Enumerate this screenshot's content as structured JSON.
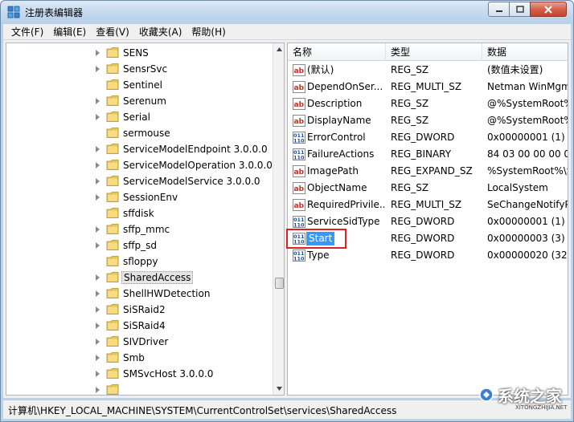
{
  "window": {
    "title": "注册表编辑器",
    "accent": "#3399ff",
    "highlight_color": "#e02020"
  },
  "menu": [
    "文件(F)",
    "编辑(E)",
    "查看(V)",
    "收藏夹(A)",
    "帮助(H)"
  ],
  "tree": {
    "items": [
      {
        "label": "SENS",
        "expandable": true
      },
      {
        "label": "SensrSvc",
        "expandable": true
      },
      {
        "label": "Sentinel",
        "expandable": false
      },
      {
        "label": "Serenum",
        "expandable": true
      },
      {
        "label": "Serial",
        "expandable": true
      },
      {
        "label": "sermouse",
        "expandable": false
      },
      {
        "label": "ServiceModelEndpoint 3.0.0.0",
        "expandable": true
      },
      {
        "label": "ServiceModelOperation 3.0.0.0",
        "expandable": true
      },
      {
        "label": "ServiceModelService 3.0.0.0",
        "expandable": true
      },
      {
        "label": "SessionEnv",
        "expandable": true
      },
      {
        "label": "sffdisk",
        "expandable": false
      },
      {
        "label": "sffp_mmc",
        "expandable": true
      },
      {
        "label": "sffp_sd",
        "expandable": true
      },
      {
        "label": "sfloppy",
        "expandable": false
      },
      {
        "label": "SharedAccess",
        "expandable": true,
        "selected": true
      },
      {
        "label": "ShellHWDetection",
        "expandable": true
      },
      {
        "label": "SiSRaid2",
        "expandable": true
      },
      {
        "label": "SiSRaid4",
        "expandable": true
      },
      {
        "label": "SIVDriver",
        "expandable": true
      },
      {
        "label": "Smb",
        "expandable": true
      },
      {
        "label": "SMSvcHost 3.0.0.0",
        "expandable": true
      },
      {
        "label": "",
        "expandable": true
      }
    ]
  },
  "list": {
    "columns": [
      "名称",
      "类型",
      "数据"
    ],
    "rows": [
      {
        "icon": "string-value-icon",
        "name": "(默认)",
        "type": "REG_SZ",
        "data": "(数值未设置)"
      },
      {
        "icon": "string-value-icon",
        "name": "DependOnSer...",
        "type": "REG_MULTI_SZ",
        "data": "Netman WinMgm"
      },
      {
        "icon": "string-value-icon",
        "name": "Description",
        "type": "REG_SZ",
        "data": "@%SystemRoot%"
      },
      {
        "icon": "string-value-icon",
        "name": "DisplayName",
        "type": "REG_SZ",
        "data": "@%SystemRoot%"
      },
      {
        "icon": "binary-value-icon",
        "name": "ErrorControl",
        "type": "REG_DWORD",
        "data": "0x00000001 (1)"
      },
      {
        "icon": "binary-value-icon",
        "name": "FailureActions",
        "type": "REG_BINARY",
        "data": "84 03 00 00 00 00"
      },
      {
        "icon": "string-value-icon",
        "name": "ImagePath",
        "type": "REG_EXPAND_SZ",
        "data": "%SystemRoot%\\S"
      },
      {
        "icon": "string-value-icon",
        "name": "ObjectName",
        "type": "REG_SZ",
        "data": "LocalSystem"
      },
      {
        "icon": "string-value-icon",
        "name": "RequiredPrivile...",
        "type": "REG_MULTI_SZ",
        "data": "SeChangeNotifyP"
      },
      {
        "icon": "binary-value-icon",
        "name": "ServiceSidType",
        "type": "REG_DWORD",
        "data": "0x00000001 (1)"
      },
      {
        "icon": "binary-value-icon",
        "name": "Start",
        "type": "REG_DWORD",
        "data": "0x00000003 (3)",
        "selected": true
      },
      {
        "icon": "binary-value-icon",
        "name": "Type",
        "type": "REG_DWORD",
        "data": "0x00000020 (32)"
      }
    ]
  },
  "status": {
    "path": "计算机\\HKEY_LOCAL_MACHINE\\SYSTEM\\CurrentControlSet\\services\\SharedAccess"
  },
  "watermark": {
    "text": "系统之家",
    "sub": "XITONGZHIJIA.NET"
  }
}
